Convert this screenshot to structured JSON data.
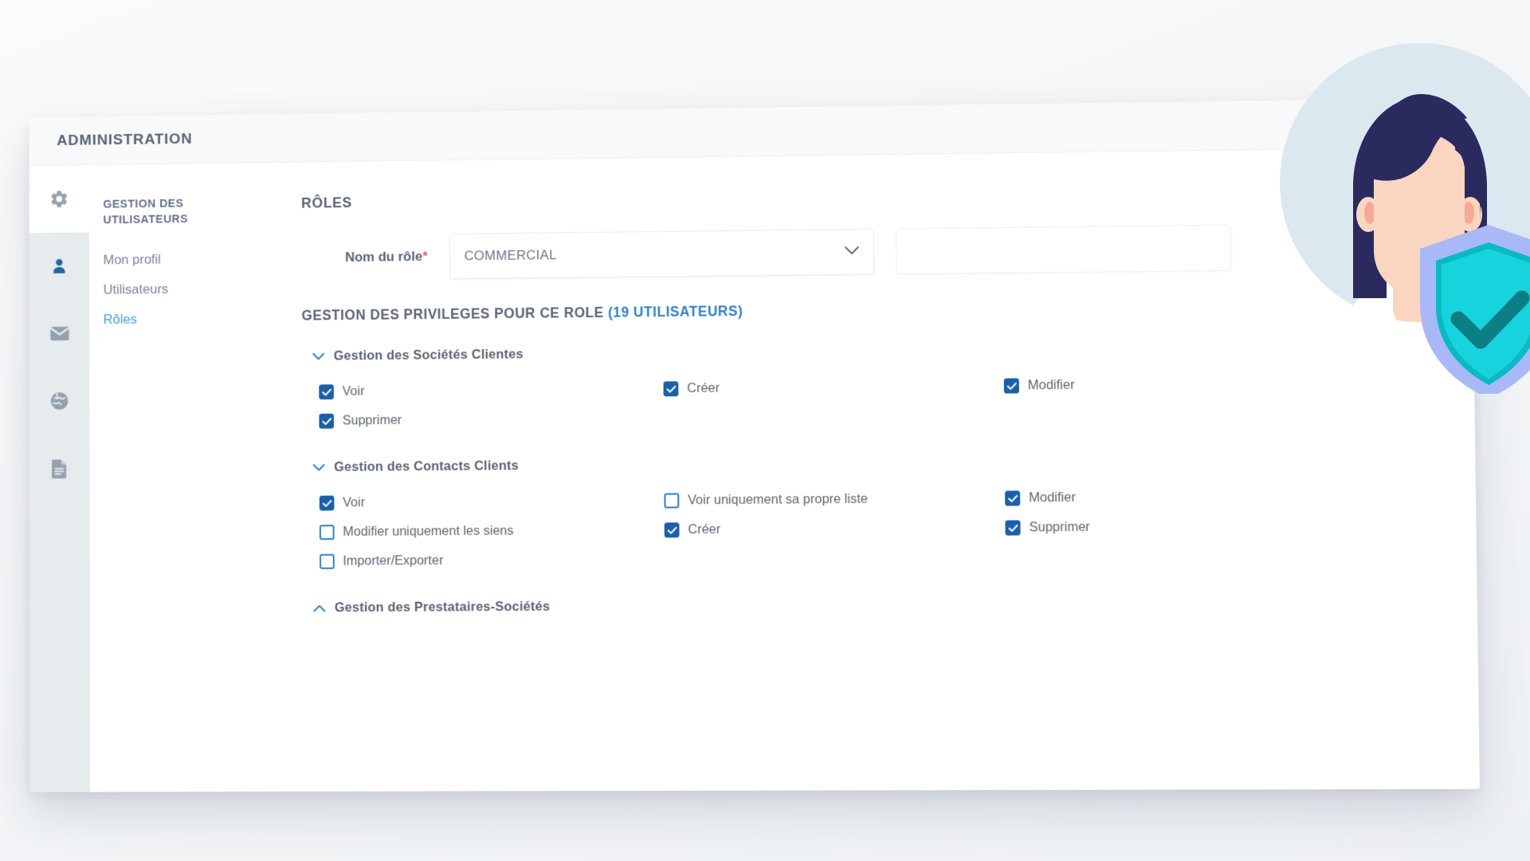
{
  "window": {
    "title": "ADMINISTRATION"
  },
  "icon_rail": [
    {
      "name": "settings",
      "icon": "gear-icon",
      "active": true
    },
    {
      "name": "users",
      "icon": "user-icon",
      "active": false
    },
    {
      "name": "messages",
      "icon": "envelope-icon",
      "active": false
    },
    {
      "name": "globe",
      "icon": "globe-icon",
      "active": false
    },
    {
      "name": "documents",
      "icon": "document-icon",
      "active": false
    }
  ],
  "sidebar": {
    "title": "GESTION DES UTILISATEURS",
    "items": [
      {
        "label": "Mon profil",
        "active": false
      },
      {
        "label": "Utilisateurs",
        "active": false
      },
      {
        "label": "Rôles",
        "active": true
      }
    ]
  },
  "main": {
    "section_title": "RÔLES",
    "role_field": {
      "label": "Nom du rôle",
      "required_marker": "*",
      "value": "COMMERCIAL"
    },
    "privileges_heading": {
      "text": "GESTION DES PRIVILEGES POUR CE ROLE ",
      "count": "(19 UTILISATEURS)"
    },
    "groups": [
      {
        "name": "Gestion des Sociétés Clientes",
        "expanded": true,
        "chevron": "chevron-down-icon",
        "permissions": [
          {
            "label": "Voir",
            "checked": true
          },
          {
            "label": "Créer",
            "checked": true
          },
          {
            "label": "Modifier",
            "checked": true
          },
          {
            "label": "Supprimer",
            "checked": true
          }
        ]
      },
      {
        "name": "Gestion des Contacts Clients",
        "expanded": true,
        "chevron": "chevron-down-icon",
        "permissions": [
          {
            "label": "Voir",
            "checked": true
          },
          {
            "label": "Voir uniquement sa propre liste",
            "checked": false
          },
          {
            "label": "Modifier",
            "checked": true
          },
          {
            "label": "Modifier uniquement les siens",
            "checked": false
          },
          {
            "label": "Créer",
            "checked": true
          },
          {
            "label": "Supprimer",
            "checked": true
          },
          {
            "label": "Importer/Exporter",
            "checked": false
          }
        ]
      },
      {
        "name": "Gestion des Prestataires-Sociétés",
        "expanded": false,
        "chevron": "chevron-up-icon",
        "permissions": []
      }
    ]
  },
  "illustration": {
    "name": "user-security-illustration",
    "circle_color": "#dce8f0",
    "hair_color": "#2b2a5e",
    "skin_color": "#fad6c0",
    "shirt_color": "#ffffff",
    "shield_outer": "#a9b9f7",
    "shield_inner": "#17d3dd",
    "check_color": "#0c7f85"
  },
  "colors": {
    "accent_blue": "#2f7fc4",
    "checkbox_on": "#1c5fa8",
    "required_red": "#f4616b",
    "text_gray": "#5a6374",
    "rail_bg": "#e6ebee"
  }
}
